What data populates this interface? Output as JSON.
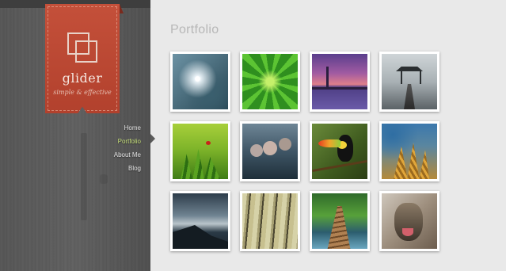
{
  "brand": {
    "name": "glider",
    "tagline": "simple & effective"
  },
  "nav": {
    "items": [
      {
        "label": "Home",
        "active": false
      },
      {
        "label": "Portfolio",
        "active": true
      },
      {
        "label": "About Me",
        "active": false
      },
      {
        "label": "Blog",
        "active": false
      }
    ]
  },
  "main": {
    "title": "Portfolio"
  },
  "portfolio": [
    {
      "subject": "dandelion"
    },
    {
      "subject": "green-leaves"
    },
    {
      "subject": "bridge-sunset"
    },
    {
      "subject": "pier-gazebo"
    },
    {
      "subject": "ladybug-grass"
    },
    {
      "subject": "snow-monkeys"
    },
    {
      "subject": "toucan"
    },
    {
      "subject": "wheat"
    },
    {
      "subject": "stormy-coast"
    },
    {
      "subject": "bamboo"
    },
    {
      "subject": "wooden-path"
    },
    {
      "subject": "wolf"
    }
  ],
  "colors": {
    "accent": "#c6df7a",
    "badge": "#b84530",
    "sidebar": "#5a5a5a",
    "background": "#e9e9e9"
  }
}
